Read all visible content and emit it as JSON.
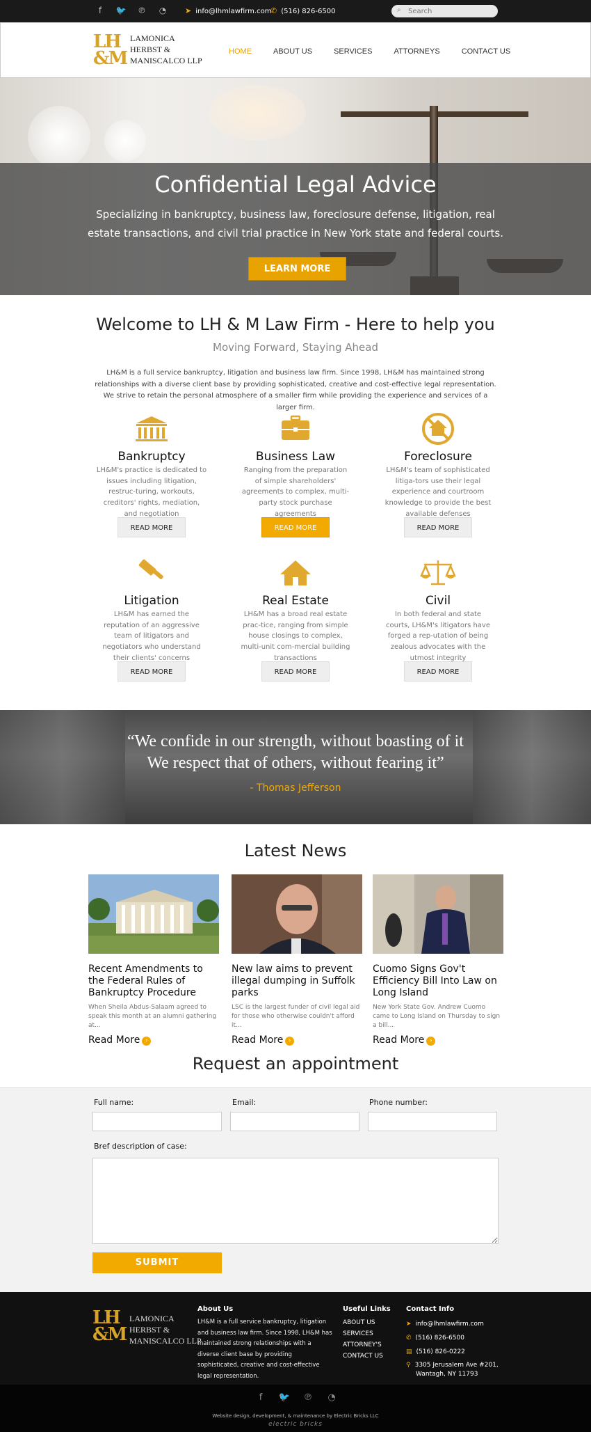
{
  "topbar": {
    "social": [
      "f",
      "t",
      "p",
      "rss"
    ],
    "email": "info@lhmlawfirm.com",
    "phone": "(516) 826-6500",
    "search_placeholder": "Search"
  },
  "header": {
    "logo_mark_top": "LH",
    "logo_mark_bottom": "&M",
    "logo_line1": "LAMONICA",
    "logo_line2": "HERBST &",
    "logo_line3": "MANISCALCO LLP",
    "nav": [
      "HOME",
      "ABOUT US",
      "SERVICES",
      "ATTORNEYS",
      "CONTACT US"
    ]
  },
  "hero": {
    "title": "Confidential Legal Advice",
    "subtitle": "Specializing in bankruptcy, business law, foreclosure defense, litigation, real estate transactions, and civil trial practice in New York state and federal courts.",
    "cta": "LEARN MORE"
  },
  "welcome": {
    "title": "Welcome to LH & M Law Firm - Here to help you",
    "subtitle": "Moving Forward, Staying Ahead",
    "description": "LH&M is a full service bankruptcy, litigation and business law firm. Since 1998, LH&M has maintained strong relationships with a diverse client base by providing sophisticated, creative and cost-effective legal representation. We strive to retain the personal atmosphere of a smaller firm while providing the experience and services of a larger firm."
  },
  "services": [
    {
      "title": "Bankruptcy",
      "text": "LH&M's practice is dedicated to issues including litigation, restruc-turing, workouts, creditors' rights, mediation, and negotiation",
      "button": "READ MORE",
      "icon": "bank-icon"
    },
    {
      "title": "Business Law",
      "text": "Ranging from the preparation of simple shareholders' agreements to complex, multi-party stock purchase agreements",
      "button": "READ MORE",
      "icon": "briefcase-icon"
    },
    {
      "title": "Foreclosure",
      "text": "LH&M's team of sophisticated litiga-tors use their legal experience and courtroom knowledge to provide the best available defenses",
      "button": "READ MORE",
      "icon": "no-house-icon"
    },
    {
      "title": "Litigation",
      "text": "LH&M has earned the reputation of an aggressive team of litigators and negotiators who understand their clients' concerns",
      "button": "READ MORE",
      "icon": "gavel-icon"
    },
    {
      "title": "Real Estate",
      "text": "LH&M has a broad real estate prac-tice, ranging from simple house closings to complex, multi-unit com-mercial building transactions",
      "button": "READ MORE",
      "icon": "house-icon"
    },
    {
      "title": "Civil",
      "text": "In both federal and state courts, LH&M's litigators have forged a rep-utation of being zealous advocates with the utmost integrity",
      "button": "READ MORE",
      "icon": "scales-icon"
    }
  ],
  "quote": {
    "line1": "“We confide in our strength, without boasting of it",
    "line2": "We respect that of others, without fearing it”",
    "author": "- Thomas Jefferson"
  },
  "news": {
    "title": "Latest News",
    "read_more": "Read More",
    "items": [
      {
        "title": "Recent Amendments to the Federal Rules of Bankruptcy Procedure",
        "excerpt": "When Sheila Abdus-Salaam agreed to speak this month at an alumni gathering at..."
      },
      {
        "title": "New law aims to prevent illegal dumping in Suffolk parks",
        "excerpt": "LSC is the largest funder of civil legal aid for those who otherwise couldn't afford it..."
      },
      {
        "title": "Cuomo Signs Gov't Efficiency Bill Into Law on Long Island",
        "excerpt": "New York State Gov. Andrew Cuomo came to Long Island on Thursday to sign a bill..."
      }
    ]
  },
  "appointment": {
    "title": "Request an appointment",
    "full_name": "Full name:",
    "email": "Email:",
    "phone": "Phone number:",
    "description": "Bref description of case:",
    "submit": "SUBMIT"
  },
  "footer": {
    "about_title": "About Us",
    "about_text": "LH&M is a full service bankruptcy, litigation and business law firm. Since 1998, LH&M has maintained strong relationships with a diverse client base by providing sophisticated, creative and cost-effective legal representation.",
    "links_title": "Useful Links",
    "links": [
      "ABOUT US",
      "SERVICES",
      "ATTORNEY'S",
      "CONTACT US"
    ],
    "contact_title": "Contact Info",
    "email": "info@lhmlawfirm.com",
    "phone": "(516) 826-6500",
    "fax": "(516) 826-0222",
    "address1": "3305 Jerusalem Ave #201,",
    "address2": "Wantagh, NY 11793",
    "credit": "Website design, development, & maintenance by Electric Bricks LLC",
    "credit_logo": "electric bricks"
  },
  "colors": {
    "accent": "#f2a900",
    "dark": "#111111"
  }
}
